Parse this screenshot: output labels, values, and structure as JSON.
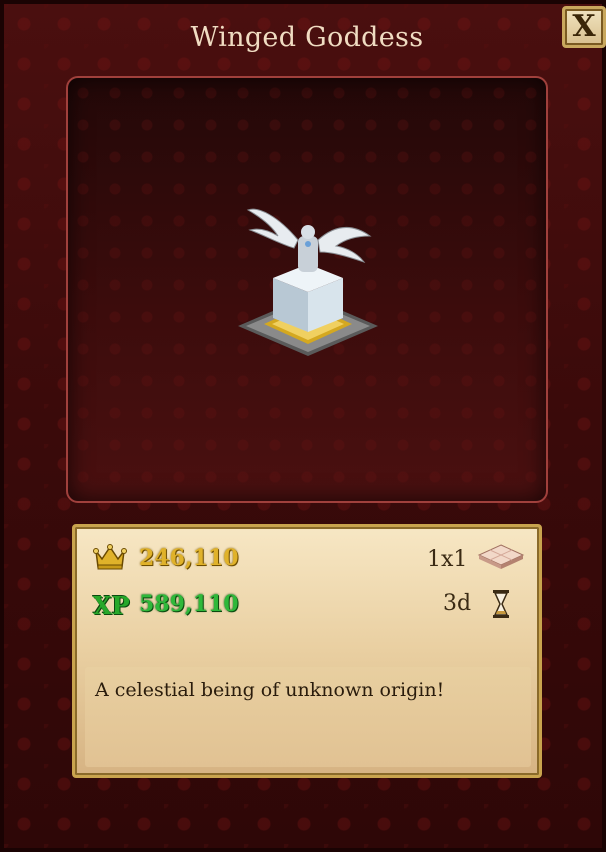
{
  "title": "Winged Goddess",
  "close_button": {
    "label": "X"
  },
  "item": {
    "image": "winged-goddess-statue",
    "coins": "246,110",
    "xp_label": "XP",
    "xp": "589,110",
    "size": "1x1",
    "build_time": "3d",
    "description": "A celestial being of unknown origin!"
  },
  "icons": {
    "coins": "crown-icon",
    "size": "tile-icon",
    "time": "hourglass-icon"
  },
  "colors": {
    "background": "#3a0a0a",
    "coins": "#e0b22a",
    "xp": "#2fb83a",
    "frame_gold": "#c9a44e"
  }
}
